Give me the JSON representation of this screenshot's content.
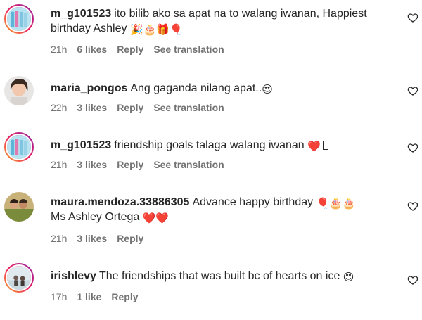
{
  "comments": [
    {
      "username": "m_g101523",
      "text": "ito bilib ako sa apat na to walang iwanan, Happiest birthday Ashley",
      "emoji": "🎉🎂🎁🎈",
      "time": "21h",
      "likes": "6 likes",
      "reply": "Reply",
      "translation": "See translation"
    },
    {
      "username": "maria_pongos",
      "text": "Ang gaganda nilang apat..",
      "emoji": "😍",
      "time": "22h",
      "likes": "3 likes",
      "reply": "Reply",
      "translation": "See translation"
    },
    {
      "username": "m_g101523",
      "text": "friendship goals talaga walang iwanan",
      "emoji": "❤️",
      "time": "21h",
      "likes": "3 likes",
      "reply": "Reply",
      "translation": "See translation"
    },
    {
      "username": "maura.mendoza.33886305",
      "text": "Advance happy birthday",
      "emoji": "🎈🎂🎂",
      "text2": "Ms Ashley Ortega",
      "emoji2": "❤️❤️",
      "time": "21h",
      "likes": "3 likes",
      "reply": "Reply"
    },
    {
      "username": "irishlevy",
      "text": "The friendships that was built bc of hearts on ice",
      "emoji": "😍",
      "time": "17h",
      "likes": "1 like",
      "reply": "Reply"
    }
  ]
}
